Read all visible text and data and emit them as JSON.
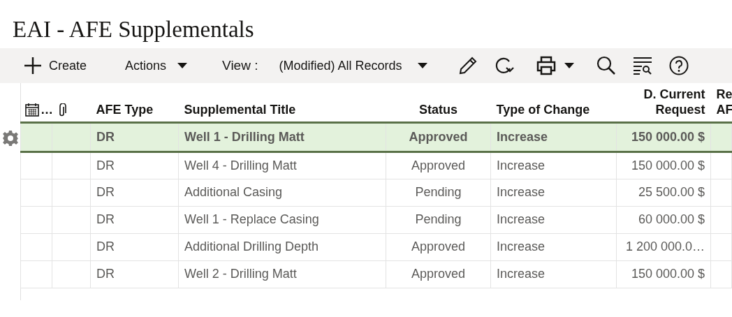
{
  "page": {
    "title": "EAI - AFE Supplementals"
  },
  "toolbar": {
    "create": "Create",
    "actions": "Actions",
    "view_label": "View :",
    "view_value": "(Modified) All Records"
  },
  "table": {
    "columns": [
      {
        "kind": "calendar",
        "label": "…"
      },
      {
        "kind": "attachment"
      },
      {
        "kind": "text",
        "label": "AFE Type"
      },
      {
        "kind": "text",
        "label": "Supplemental Title"
      },
      {
        "kind": "text",
        "label": "Status"
      },
      {
        "kind": "text",
        "label": "Type of Change"
      },
      {
        "kind": "text",
        "label": "D. Current Request"
      },
      {
        "kind": "text",
        "label": "Re AF"
      }
    ],
    "rows": [
      {
        "selected": true,
        "cells": [
          null,
          null,
          "DR",
          "Well 1 - Drilling Matt",
          "Approved",
          "Increase",
          "150 000.00 $",
          null
        ]
      },
      {
        "selected": false,
        "cells": [
          null,
          null,
          "DR",
          "Well 4 - Drilling Matt",
          "Approved",
          "Increase",
          "150 000.00 $",
          null
        ]
      },
      {
        "selected": false,
        "cells": [
          null,
          null,
          "DR",
          "Additional Casing",
          "Pending",
          "Increase",
          "25 500.00 $",
          null
        ]
      },
      {
        "selected": false,
        "cells": [
          null,
          null,
          "DR",
          "Well 1 - Replace Casing",
          "Pending",
          "Increase",
          "60 000.00 $",
          null
        ]
      },
      {
        "selected": false,
        "cells": [
          null,
          null,
          "DR",
          "Additional Drilling Depth",
          "Approved",
          "Increase",
          "1 200 000.0…",
          null
        ]
      },
      {
        "selected": false,
        "cells": [
          null,
          null,
          "DR",
          "Well 2 - Drilling Matt",
          "Approved",
          "Increase",
          "150 000.00 $",
          null
        ]
      }
    ]
  }
}
